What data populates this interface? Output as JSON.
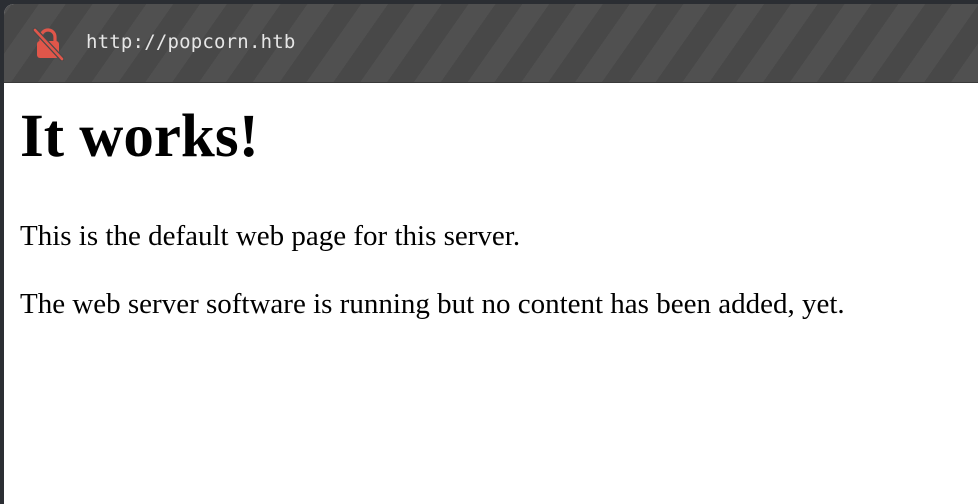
{
  "browser": {
    "url": "http://popcorn.htb",
    "security_icon": "insecure-lock-icon",
    "security_icon_color": "#e0564a"
  },
  "page": {
    "heading": "It works!",
    "paragraphs": [
      "This is the default web page for this server.",
      "The web server software is running but no content has been added, yet."
    ]
  }
}
